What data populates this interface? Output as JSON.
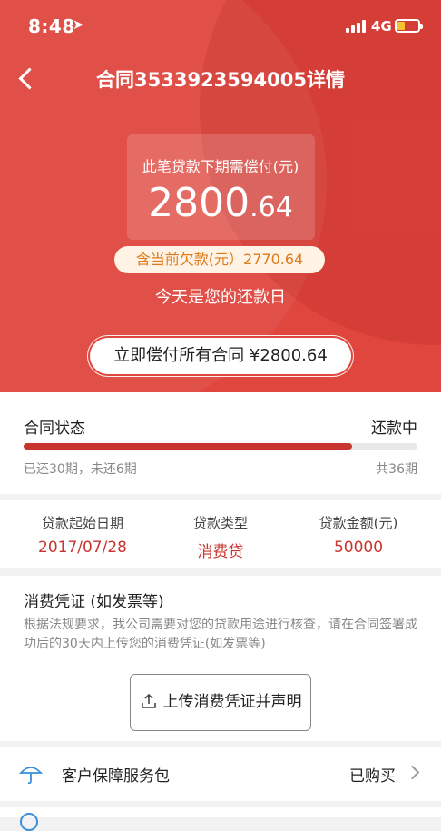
{
  "status_bar": {
    "time": "8:48",
    "network": "4G",
    "battery_percent": 35,
    "battery_color": "#f5c32c"
  },
  "header": {
    "title": "合同3533923594005详情"
  },
  "hero": {
    "bg_color": "#e0463d",
    "amount_label": "此笔贷款下期需偿付(元)",
    "amount_int": "2800",
    "amount_dec": ".64",
    "overdue_label": "含当前欠款(元）2770.64",
    "today_notice": "今天是您的还款日",
    "pay_all_label": "立即偿付所有合同 ¥2800.64"
  },
  "contract_status": {
    "label": "合同状态",
    "value": "还款中",
    "progress_fraction": 0.833,
    "progress_text": "已还30期，未还6期",
    "total_text": "共36期"
  },
  "loan_info": [
    {
      "header": "贷款起始日期",
      "value": "2017/07/28"
    },
    {
      "header": "贷款类型",
      "value": "消费贷"
    },
    {
      "header": "贷款金额(元)",
      "value": "50000"
    }
  ],
  "voucher": {
    "title": "消费凭证 (如发票等)",
    "description": "根据法规要求，我公司需要对您的贷款用途进行核查，请在合同签署成功后的30天内上传您的消费凭证(如发票等)",
    "upload_label": "上传消费凭证并声明"
  },
  "service_pack": {
    "label": "客户保障服务包",
    "status": "已购买",
    "icon": "umbrella-icon"
  }
}
